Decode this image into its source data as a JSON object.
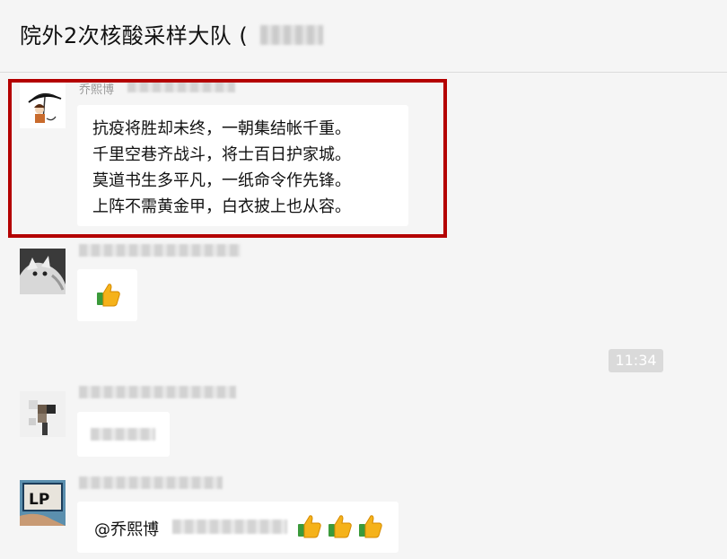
{
  "chat": {
    "title": "院外2次核酸采样大队 (",
    "time_divider": "11:34"
  },
  "messages": [
    {
      "sender": "乔熙博",
      "lines": [
        "抗疫将胜却未终，一朝集结帐千重。",
        "千里空巷齐战斗，将士百日护家城。",
        "莫道书生多平凡，一纸命令作先锋。",
        "上阵不需黄金甲，白衣披上也从容。"
      ]
    },
    {
      "sender": "",
      "icon": "thumbs-up-icon"
    },
    {
      "sender": "",
      "text": ""
    },
    {
      "sender": "",
      "mention": "@乔熙博",
      "icons": [
        "thumbs-up-icon",
        "thumbs-up-icon",
        "thumbs-up-icon"
      ]
    }
  ],
  "colors": {
    "highlight_border": "#b40000",
    "background": "#f5f5f5",
    "bubble": "#ffffff"
  },
  "avatars": [
    {
      "text": ""
    },
    {
      "text": ""
    },
    {
      "text": ""
    },
    {
      "text": "LP"
    }
  ]
}
